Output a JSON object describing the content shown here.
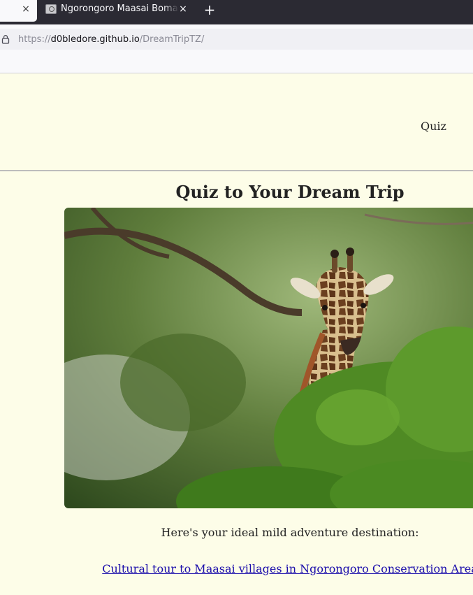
{
  "browser": {
    "tabs": [
      {
        "title": "",
        "active": true
      },
      {
        "title": "Ngorongoro Maasai Boma Cultural Tour",
        "active": false
      }
    ],
    "url": {
      "scheme": "https://",
      "host": "d0bledore.github.io",
      "path": "/DreamTripTZ/"
    }
  },
  "site": {
    "nav": {
      "quiz_label": "Quiz"
    },
    "title": "Quiz to Your Dream Trip",
    "hero_image": "giraffe",
    "result_intro": "Here's your ideal mild adventure destination:",
    "result_link": "Cultural tour to Maasai villages in Ngorongoro Conservation Area"
  },
  "colors": {
    "page_bg": "#fdfde8",
    "link": "#1a0dab",
    "tabstrip": "#2b2a33"
  }
}
